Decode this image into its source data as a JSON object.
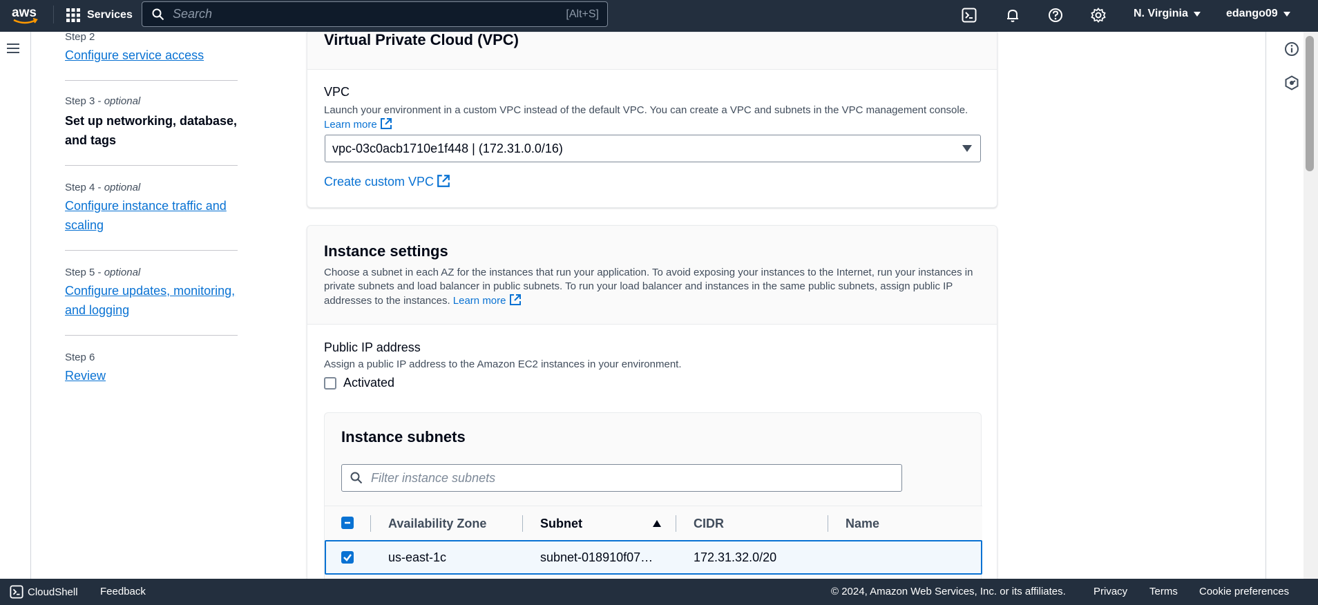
{
  "topnav": {
    "logo_text": "aws",
    "services_label": "Services",
    "search_placeholder": "Search",
    "search_shortcut": "[Alt+S]",
    "region": "N. Virginia",
    "user": "edango09"
  },
  "steps": [
    {
      "label": "Step 2",
      "optional": "",
      "title": "Configure service access"
    },
    {
      "label": "Step 3 - ",
      "optional": "optional",
      "title": "Set up networking, database, and tags"
    },
    {
      "label": "Step 4 - ",
      "optional": "optional",
      "title": "Configure instance traffic and scaling"
    },
    {
      "label": "Step 5 - ",
      "optional": "optional",
      "title": "Configure updates, monitoring, and logging"
    },
    {
      "label": "Step 6",
      "optional": "",
      "title": "Review"
    }
  ],
  "vpc_section": {
    "title": "Virtual Private Cloud (VPC)",
    "vpc_label": "VPC",
    "vpc_description": "Launch your environment in a custom VPC instead of the default VPC. You can create a VPC and subnets in the VPC management console.",
    "learn_more": "Learn more",
    "vpc_selected": "vpc-03c0acb1710e1f448 | (172.31.0.0/16)",
    "create_custom_vpc": "Create custom VPC"
  },
  "instance_settings": {
    "title": "Instance settings",
    "description": "Choose a subnet in each AZ for the instances that run your application. To avoid exposing your instances to the Internet, run your instances in private subnets and load balancer in public subnets. To run your load balancer and instances in the same public subnets, assign public IP addresses to the instances.",
    "learn_more": "Learn more",
    "public_ip_label": "Public IP address",
    "public_ip_description": "Assign a public IP address to the Amazon EC2 instances in your environment.",
    "activated_label": "Activated"
  },
  "instance_subnets": {
    "title": "Instance subnets",
    "filter_placeholder": "Filter instance subnets",
    "columns": [
      "Availability Zone",
      "Subnet",
      "CIDR",
      "Name"
    ],
    "rows": [
      {
        "az": "us-east-1c",
        "subnet": "subnet-018910f07…",
        "cidr": "172.31.32.0/20",
        "name": ""
      }
    ]
  },
  "footer": {
    "cloudshell": "CloudShell",
    "feedback": "Feedback",
    "copyright": "© 2024, Amazon Web Services, Inc. or its affiliates.",
    "privacy": "Privacy",
    "terms": "Terms",
    "cookie": "Cookie preferences"
  },
  "colors": {
    "nav_bg": "#232f3e",
    "link": "#0972d3",
    "aws_orange": "#ff9900"
  }
}
